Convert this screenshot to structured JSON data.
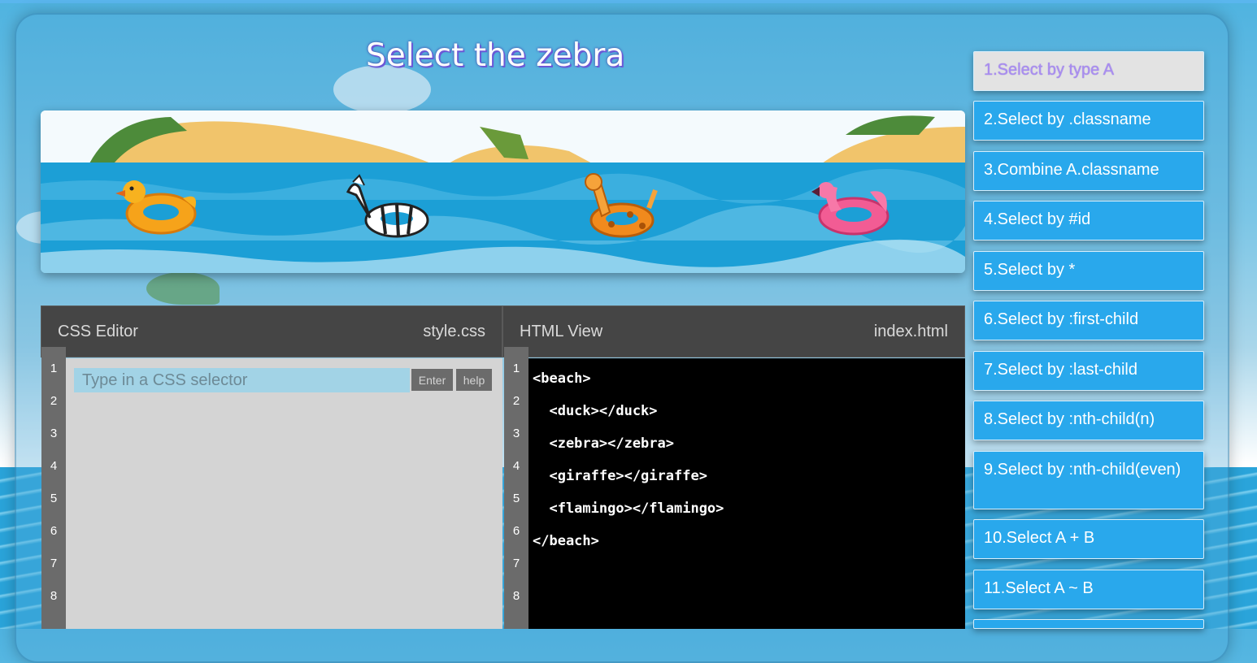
{
  "level": {
    "title": "Select the zebra"
  },
  "css_editor": {
    "title": "CSS Editor",
    "filename": "style.css",
    "input_placeholder": "Type in a CSS selector",
    "input_value": "",
    "enter_label": "Enter",
    "help_label": "help",
    "line_numbers": [
      "1",
      "2",
      "3",
      "4",
      "5",
      "6",
      "7",
      "8"
    ]
  },
  "html_view": {
    "title": "HTML View",
    "filename": "index.html",
    "line_numbers": [
      "1",
      "2",
      "3",
      "4",
      "5",
      "6",
      "7",
      "8"
    ],
    "lines": [
      "<beach>",
      "  <duck></duck>",
      "  <zebra></zebra>",
      "  <giraffe></giraffe>",
      "  <flamingo></flamingo>",
      "</beach>"
    ]
  },
  "scene": {
    "items": [
      "duck",
      "zebra",
      "giraffe",
      "flamingo"
    ]
  },
  "levels": [
    {
      "label": "1.Select by type A",
      "active": true
    },
    {
      "label": "2.Select by .classname",
      "active": false
    },
    {
      "label": "3.Combine A.classname",
      "active": false
    },
    {
      "label": "4.Select by #id",
      "active": false
    },
    {
      "label": "5.Select by *",
      "active": false
    },
    {
      "label": "6.Select by :first-child",
      "active": false
    },
    {
      "label": "7.Select by :last-child",
      "active": false
    },
    {
      "label": "8.Select by :nth-child(n)",
      "active": false
    },
    {
      "label": "9.Select by :nth-child(even)",
      "active": false
    },
    {
      "label": "10.Select A + B",
      "active": false
    },
    {
      "label": "11.Select A ~ B",
      "active": false
    }
  ],
  "colors": {
    "sidebar_item": "#29a8ec",
    "sidebar_active": "#e3e3e3",
    "editor_header": "#454545",
    "css_input": "#a2d3e6",
    "html_bg": "#000000"
  }
}
